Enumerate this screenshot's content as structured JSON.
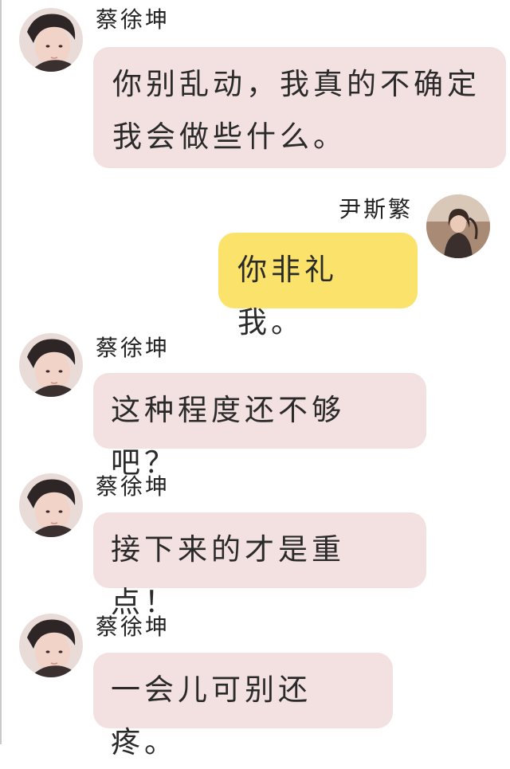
{
  "theme": {
    "pink_bubble": "#f3e0e0",
    "yellow_bubble": "#fbe36b",
    "text_color": "#2a2a2a"
  },
  "messages": [
    {
      "side": "left",
      "sender": "蔡徐坤",
      "avatar_icon": "male-avatar",
      "text": "你别乱动，我真的不确定我会做些什么。"
    },
    {
      "side": "right",
      "sender": "尹斯繁",
      "avatar_icon": "female-avatar",
      "text": "你非礼我。"
    },
    {
      "side": "left",
      "sender": "蔡徐坤",
      "avatar_icon": "male-avatar",
      "text": "这种程度还不够吧？"
    },
    {
      "side": "left",
      "sender": "蔡徐坤",
      "avatar_icon": "male-avatar",
      "text": "接下来的才是重点！"
    },
    {
      "side": "left",
      "sender": "蔡徐坤",
      "avatar_icon": "male-avatar",
      "text": "一会儿可别还疼。"
    }
  ]
}
